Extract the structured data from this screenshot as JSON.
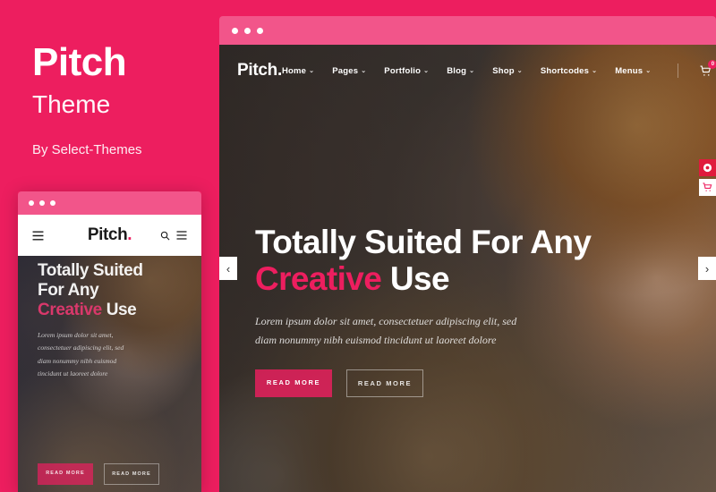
{
  "promo": {
    "title": "Pitch",
    "subtitle": "Theme",
    "byline": "By Select-Themes"
  },
  "desktop_window": {
    "titlebar": {
      "dots": [
        "dot-1",
        "dot-2",
        "dot-3"
      ],
      "color": "#F2558A"
    },
    "nav": {
      "logo": "Pitch.",
      "items": [
        {
          "label": "Home",
          "has_dropdown": true
        },
        {
          "label": "Pages",
          "has_dropdown": true
        },
        {
          "label": "Portfolio",
          "has_dropdown": true
        },
        {
          "label": "Blog",
          "has_dropdown": true
        },
        {
          "label": "Shop",
          "has_dropdown": true
        },
        {
          "label": "Shortcodes",
          "has_dropdown": true
        },
        {
          "label": "Menus",
          "has_dropdown": true
        }
      ],
      "chevron": "⌄",
      "cart_badge": "0",
      "icons": [
        "cart-icon",
        "search-icon",
        "hamburger-icon"
      ]
    },
    "hero": {
      "heading_line1": "Totally Suited For Any",
      "heading_accent": "Creative",
      "heading_tail": "Use",
      "paragraph": "Lorem ipsum dolor sit amet, consectetuer adipiscing elit, sed diam nonummy nibh euismod tincidunt ut laoreet dolore",
      "button_primary": "READ MORE",
      "button_secondary": "READ MORE"
    },
    "slider": {
      "prev": "‹",
      "next": "›"
    }
  },
  "mobile_window": {
    "titlebar": {
      "dots": [
        "dot-1",
        "dot-2",
        "dot-3"
      ],
      "color": "#F2558A"
    },
    "nav": {
      "logo": "Pitch",
      "logo_dot": ".",
      "icons": [
        "hamburger-icon",
        "search-icon",
        "menu-icon"
      ]
    },
    "hero": {
      "heading_line1": "Totally Suited",
      "heading_line2": "For Any",
      "heading_accent": "Creative",
      "heading_tail": "Use",
      "paragraph": "Lorem ipsum dolor sit amet, consectetuer adipiscing elit, sed diam nonummy nibh euismod tincidunt ut laoreet dolore",
      "button_primary": "READ MORE",
      "button_secondary": "READ MORE"
    }
  },
  "side_buttons": [
    {
      "name": "buy-now-button",
      "color": "#E01B3C"
    },
    {
      "name": "cart-button",
      "color": "#FFFFFF"
    }
  ],
  "colors": {
    "brand_pink": "#ED1E5F",
    "titlebar_pink": "#F2558A",
    "accent_red": "#E01B3C"
  }
}
